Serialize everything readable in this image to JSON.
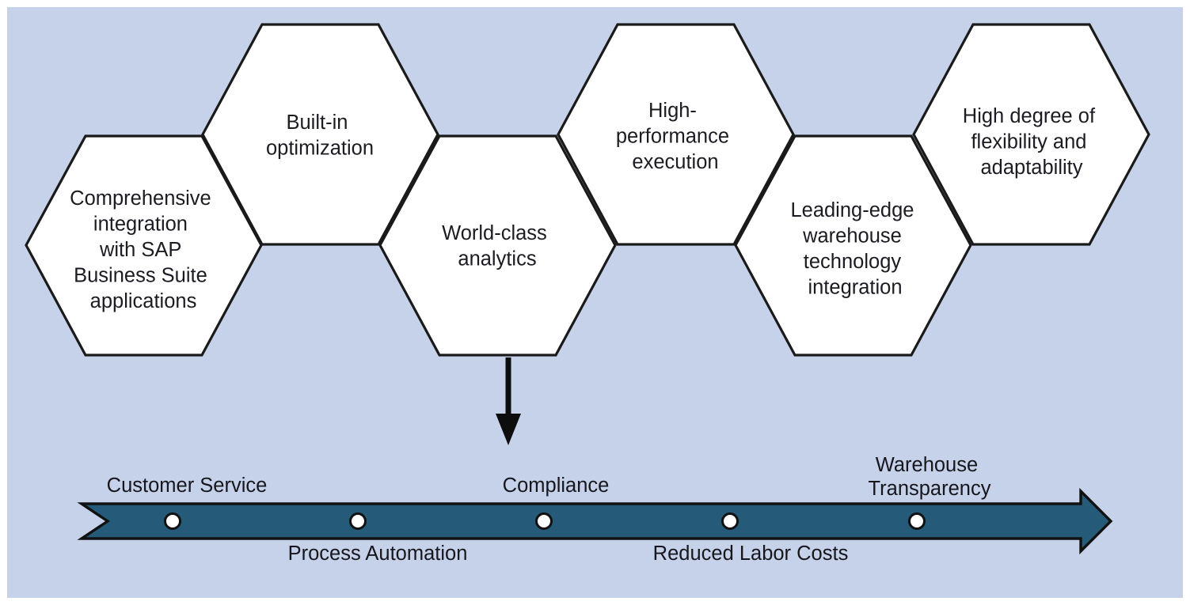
{
  "diagram": {
    "title": "SAP EWM benefits hexagon diagram",
    "background_color": "#c6d2ea",
    "frame_color": "#ffffff",
    "hexagons": [
      {
        "id": "comprehensive-integration",
        "lines": [
          "Comprehensive",
          "integration",
          "with SAP",
          "Business Suite",
          "applications"
        ],
        "fill": "#ffffff",
        "stroke": "#1a1a1a",
        "row": "lower"
      },
      {
        "id": "built-in-optimization",
        "lines": [
          "Built-in",
          "optimization"
        ],
        "fill": "#ffffff",
        "stroke": "#1a1a1a",
        "row": "upper"
      },
      {
        "id": "world-class-analytics",
        "lines": [
          "World-class",
          "analytics"
        ],
        "fill": "#ffffff",
        "stroke": "#1a1a1a",
        "row": "lower"
      },
      {
        "id": "high-performance-execution",
        "lines": [
          "High-",
          "performance",
          "execution"
        ],
        "fill": "#ffffff",
        "stroke": "#1a1a1a",
        "row": "upper"
      },
      {
        "id": "leading-edge-warehouse-technology",
        "lines": [
          "Leading-edge",
          "warehouse",
          "technology",
          "integration"
        ],
        "fill": "#ffffff",
        "stroke": "#1a1a1a",
        "row": "lower"
      },
      {
        "id": "high-degree-flexibility",
        "lines": [
          "High degree of",
          "flexibility and",
          "adaptability"
        ],
        "fill": "#ffffff",
        "stroke": "#1a1a1a",
        "row": "upper"
      }
    ],
    "connector_arrow": {
      "id": "downward-arrow",
      "color": "#0d0d0d",
      "direction": "down"
    },
    "outcome_arrow": {
      "id": "outcome-arrow-bar",
      "fill": "#255a78",
      "stroke": "#111111",
      "direction": "right",
      "marker_fill": "#ffffff",
      "marker_stroke": "#111111",
      "markers": [
        {
          "id": "marker-customer-service",
          "label": "Customer Service",
          "label_position": "above"
        },
        {
          "id": "marker-process-automation",
          "label": "Process Automation",
          "label_position": "below"
        },
        {
          "id": "marker-compliance",
          "label": "Compliance",
          "label_position": "above"
        },
        {
          "id": "marker-reduced-labor-costs",
          "label": "Reduced Labor Costs",
          "label_position": "below"
        },
        {
          "id": "marker-warehouse-transparency",
          "label": "Warehouse\nTransparency",
          "label_position": "above",
          "label_line1": "Warehouse",
          "label_line2": "Transparency"
        }
      ]
    }
  }
}
